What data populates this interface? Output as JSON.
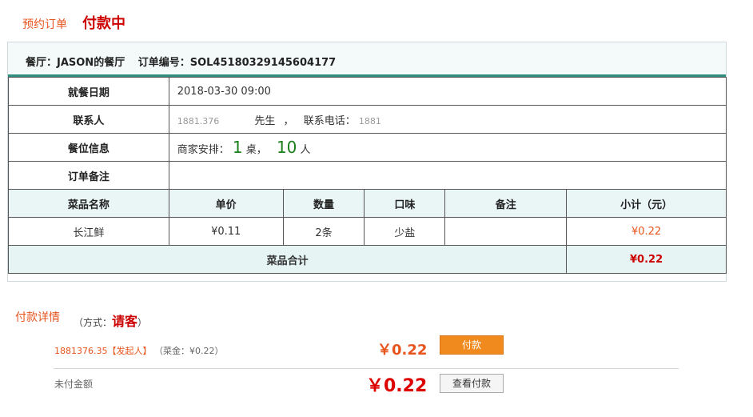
{
  "header": {
    "title": "预约订单",
    "status": "付款中"
  },
  "order": {
    "restaurant_label": "餐厅：JASON的餐厅",
    "order_no_label": "订单编号：SOL45180329145604177"
  },
  "info": {
    "dining_date_label": "就餐日期",
    "dining_date_value": "2018-03-30  09:00",
    "contact_label": "联系人",
    "contact_name": "1881.376",
    "contact_title": "先生",
    "contact_sep": "，",
    "phone_label": "联系电话：",
    "phone_value": "1881",
    "seat_label": "餐位信息",
    "seat_prefix": "商家安排：",
    "tables": "1",
    "tables_unit": "桌，",
    "people": "10",
    "people_unit": "人",
    "remark_label": "订单备注",
    "remark_value": ""
  },
  "dishes": {
    "columns": [
      "菜品名称",
      "单价",
      "数量",
      "口味",
      "备注",
      "小计（元）"
    ],
    "rows": [
      {
        "name": "长江鲜",
        "price": "¥0.11",
        "qty": "2条",
        "taste": "少盐",
        "note": "",
        "subtotal": "¥0.22"
      }
    ],
    "total_label": "菜品合计",
    "total_value": "¥0.22"
  },
  "payment": {
    "title": "付款详情",
    "method_prefix": "（方式：",
    "method_value": "请客",
    "method_suffix": "）",
    "payer_phone": "1881376.35",
    "payer_role": "【发起人】",
    "payer_detail": "（菜金：¥0.22）",
    "payer_amount": "￥0.22",
    "pay_button": "付款",
    "unpaid_label": "未付金额",
    "unpaid_amount": "￥0.22",
    "view_button": "查看付款"
  },
  "colors": {
    "accent": "#e8541e",
    "status": "#cc0000",
    "teal": "#2f8f7e",
    "green": "#1a7f1a"
  }
}
